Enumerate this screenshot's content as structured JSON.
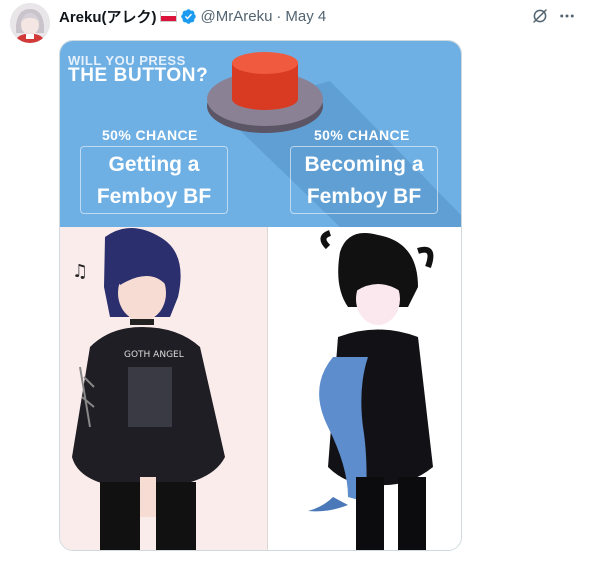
{
  "author": {
    "name": "Areku(アレク)",
    "handle": "@MrAreku",
    "separator": "·",
    "date": "May 4",
    "verified": true
  },
  "icons": {
    "grok": "grok-icon",
    "more": "more-icon"
  },
  "media": {
    "line1": "WILL YOU PRESS",
    "line2": "THE BUTTON?",
    "left_chance": "50% CHANCE",
    "right_chance": "50% CHANCE",
    "left_option": [
      "Getting a",
      "Femboy BF"
    ],
    "right_option": [
      "Becoming a",
      "Femboy BF"
    ]
  },
  "colors": {
    "banner": "#6fb0e4",
    "button_red": "#e8452c",
    "verified_blue": "#1d9bf0"
  }
}
